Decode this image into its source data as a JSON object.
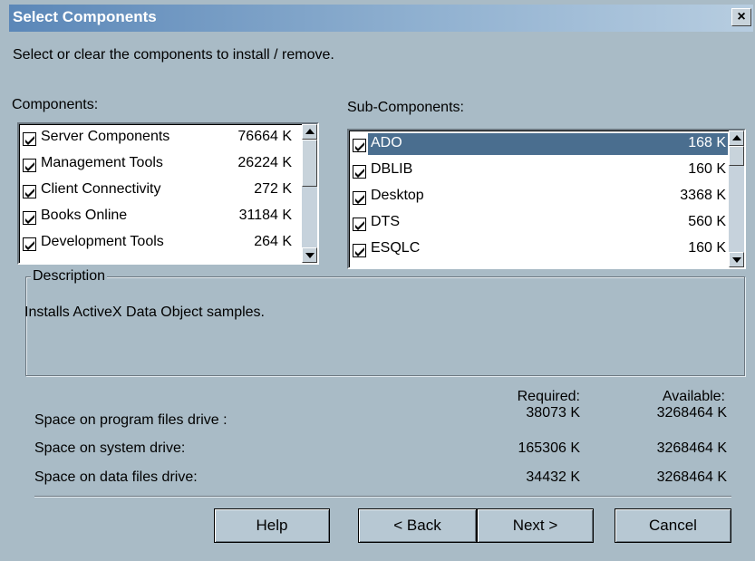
{
  "window": {
    "title": "Select Components",
    "close_label": "×"
  },
  "instruction": "Select or clear the components to install / remove.",
  "components": {
    "label": "Components:",
    "items": [
      {
        "name": "Server Components",
        "size": "76664 K",
        "checked": true
      },
      {
        "name": "Management Tools",
        "size": "26224 K",
        "checked": true
      },
      {
        "name": "Client Connectivity",
        "size": "272 K",
        "checked": true
      },
      {
        "name": "Books Online",
        "size": "31184 K",
        "checked": true
      },
      {
        "name": "Development Tools",
        "size": "264 K",
        "checked": true
      }
    ]
  },
  "subcomponents": {
    "label": "Sub-Components:",
    "items": [
      {
        "name": "ADO",
        "size": "168 K",
        "checked": true,
        "selected": true
      },
      {
        "name": "DBLIB",
        "size": "160 K",
        "checked": true
      },
      {
        "name": "Desktop",
        "size": "3368 K",
        "checked": true
      },
      {
        "name": "DTS",
        "size": "560 K",
        "checked": true
      },
      {
        "name": "ESQLC",
        "size": "160 K",
        "checked": true
      }
    ]
  },
  "description": {
    "legend": "Description",
    "text": "Installs ActiveX Data Object samples."
  },
  "space": {
    "required_header": "Required:",
    "available_header": "Available:",
    "rows": [
      {
        "label": "Space on program files drive :",
        "required": "38073 K",
        "available": "3268464 K"
      },
      {
        "label": "Space on system drive:",
        "required": "165306 K",
        "available": "3268464 K"
      },
      {
        "label": "Space on data files drive:",
        "required": "34432 K",
        "available": "3268464 K"
      }
    ]
  },
  "buttons": {
    "help": "Help",
    "back": "< Back",
    "next": "Next >",
    "cancel": "Cancel"
  },
  "colors": {
    "background": "#a9bbc6",
    "selection": "#4a6e8f",
    "title_gradient_start": "#5b87b8"
  }
}
